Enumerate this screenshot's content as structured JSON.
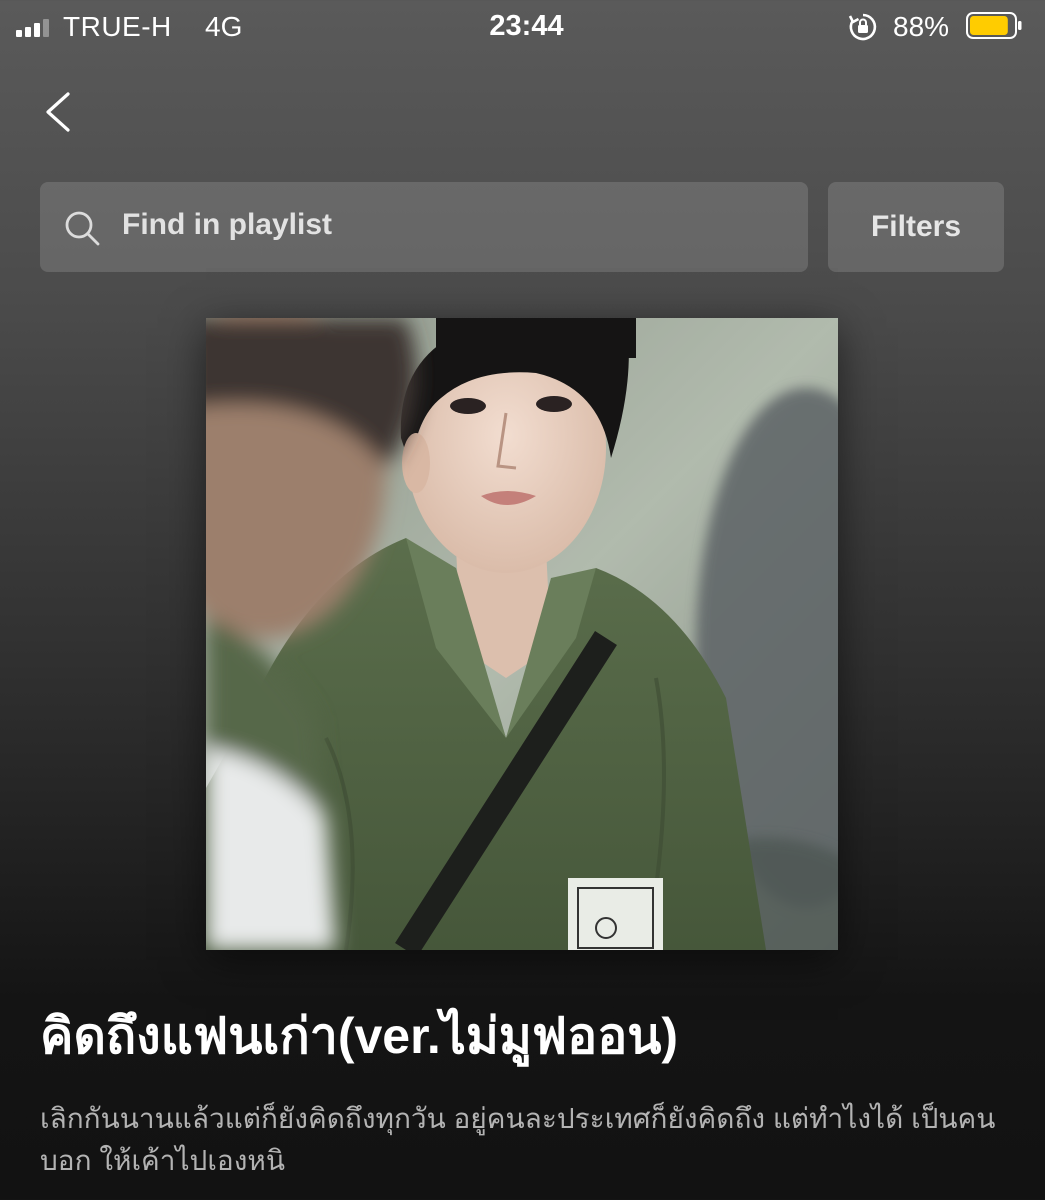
{
  "status_bar": {
    "carrier": "TRUE-H",
    "network": "4G",
    "time": "23:44",
    "battery_percent": "88%",
    "battery_level": 0.88,
    "battery_color": "#ffcc00",
    "icons": [
      "signal-icon",
      "orientation-lock-icon",
      "battery-icon"
    ]
  },
  "nav": {
    "back_icon": "chevron-left-icon"
  },
  "search": {
    "placeholder": "Find in playlist",
    "icon": "search-icon"
  },
  "filters": {
    "label": "Filters"
  },
  "playlist": {
    "title": "คิดถึงแฟนเก่า(ver.ไม่มูฟออน)",
    "description": "เลิกกันนานแล้วแต่ก็ยังคิดถึงทุกวัน อยู่คนละประเทศก็ยังคิดถึง แต่ทำไงได้ เป็นคนบอก ให้เค้าไปเองหนิ"
  },
  "colors": {
    "background_top": "#5a5a5a",
    "background_bottom": "#121212",
    "text_primary": "#ffffff",
    "text_secondary": "#b3b3b3",
    "field_background": "rgba(255,255,255,0.14)"
  }
}
